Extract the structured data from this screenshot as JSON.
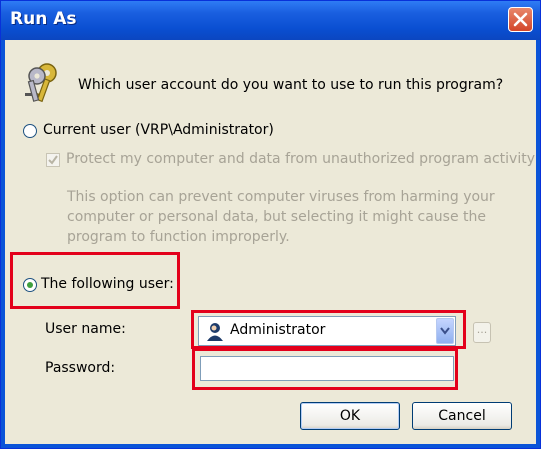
{
  "window": {
    "title": "Run As"
  },
  "prompt": "Which user account do you want to use to run this program?",
  "current_user": {
    "label": "Current user (VRP\\Administrator)",
    "selected": false,
    "protect_label": "Protect my computer and data from unauthorized program activity",
    "protect_checked": true,
    "description": "This option can prevent computer viruses from harming your computer or personal data, but selecting it might cause the program to function improperly."
  },
  "following_user": {
    "label": "The following user:",
    "selected": true
  },
  "user_name": {
    "label": "User name:",
    "value": "Administrator",
    "browse_label": "..."
  },
  "password": {
    "label": "Password:",
    "value": ""
  },
  "buttons": {
    "ok": "OK",
    "cancel": "Cancel"
  },
  "colors": {
    "title_bar": "#0a4fd2",
    "dialog_bg": "#ece9d8",
    "highlight": "#e3001b",
    "disabled_text": "#a7a396"
  }
}
